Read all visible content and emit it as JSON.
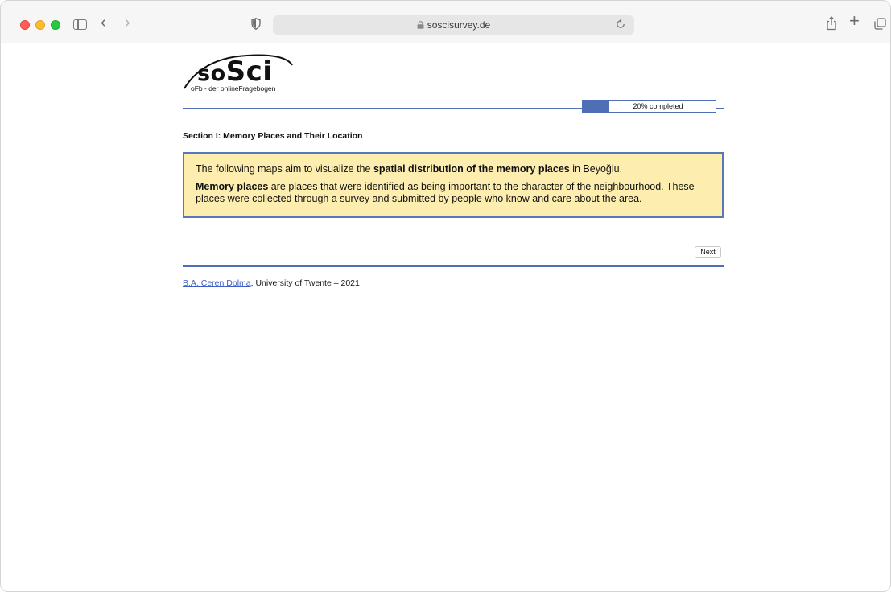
{
  "browser": {
    "url": "soscisurvey.de",
    "back_icon": "chevron-left-icon",
    "forward_icon": "chevron-right-icon",
    "plus_glyph": "+"
  },
  "logo": {
    "main_small": "so",
    "main_big": "Sci",
    "subtitle": "oFb - der onlineFragebogen"
  },
  "progress": {
    "value": 0.2,
    "label": "20% completed",
    "color": "#4e6fb5"
  },
  "section": {
    "title": "Section I: Memory Places and Their Location"
  },
  "info": {
    "p1_before": "The following maps aim to visualize the ",
    "p1_bold": "spatial distribution of the memory places",
    "p1_after": " in Beyoğlu.",
    "p2_bold": "Memory places",
    "p2_text": " are places that were identified as being important to the character of the neighbourhood. These places were collected through a survey and submitted by people who know and care about the area.",
    "background": "#fdeeb0",
    "border": "#5878b8"
  },
  "nav": {
    "next_label": "Next"
  },
  "footer": {
    "link_text": "B.A. Ceren Dolma",
    "rest_text": ", University of Twente – 2021"
  }
}
